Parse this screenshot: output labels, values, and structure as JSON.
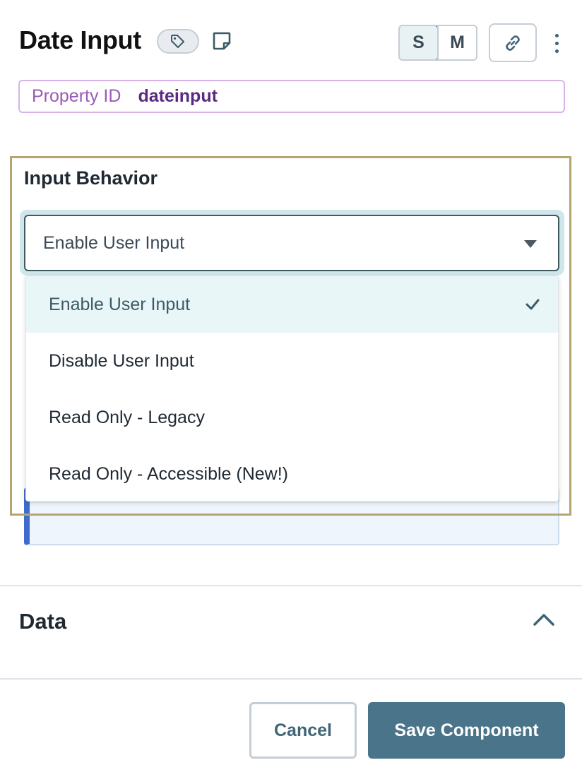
{
  "header": {
    "title": "Date Input",
    "size_small": "S",
    "size_medium": "M",
    "active_size": "S"
  },
  "property_id": {
    "label": "Property ID",
    "value": "dateinput"
  },
  "input_behavior": {
    "label": "Input Behavior",
    "selected": "Enable User Input",
    "options": [
      {
        "label": "Enable User Input",
        "selected": true
      },
      {
        "label": "Disable User Input",
        "selected": false
      },
      {
        "label": "Read Only - Legacy",
        "selected": false
      },
      {
        "label": "Read Only - Accessible (New!)",
        "selected": false
      }
    ]
  },
  "data_section": {
    "title": "Data",
    "expanded": true
  },
  "footer": {
    "cancel_label": "Cancel",
    "save_label": "Save Component"
  },
  "icons": {
    "tag": "tag-icon",
    "note": "note-icon",
    "link": "link-icon",
    "more": "more-vertical-icon",
    "dropdown_arrow": "caret-down-icon",
    "check": "check-icon",
    "collapse": "chevron-up-icon"
  },
  "colors": {
    "primary": "#4a7489",
    "property_id_border": "#d7b3ea",
    "property_id_value": "#5a2a82",
    "highlight_border": "#b3a673",
    "selected_option_bg": "#e9f6f8"
  }
}
